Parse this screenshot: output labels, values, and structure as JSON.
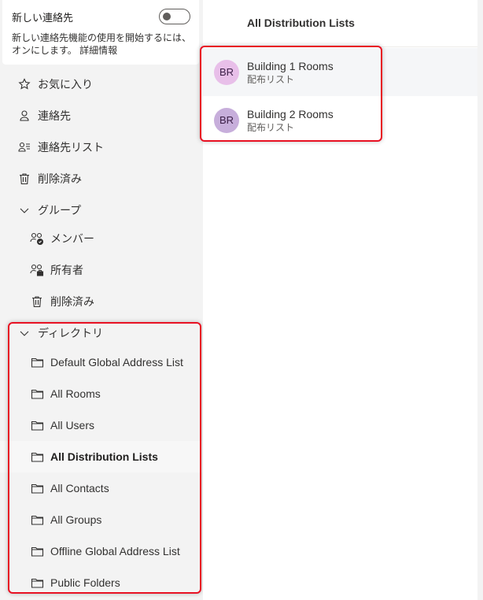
{
  "new_contacts": {
    "title": "新しい連絡先",
    "description": "新しい連絡先機能の使用を開始するには、オンにします。",
    "more_link": "詳細情報",
    "toggle_on": false
  },
  "nav": {
    "favorites": "お気に入り",
    "contacts": "連絡先",
    "contact_lists": "連絡先リスト",
    "deleted": "削除済み",
    "groups": {
      "label": "グループ",
      "expanded": true,
      "items": [
        {
          "label": "メンバー",
          "icon": "people-check-icon"
        },
        {
          "label": "所有者",
          "icon": "people-owner-icon"
        },
        {
          "label": "削除済み",
          "icon": "trash-icon"
        }
      ]
    },
    "directory": {
      "label": "ディレクトリ",
      "expanded": true,
      "items": [
        {
          "label": "Default Global Address List"
        },
        {
          "label": "All Rooms"
        },
        {
          "label": "All Users"
        },
        {
          "label": "All Distribution Lists",
          "selected": true
        },
        {
          "label": "All Contacts"
        },
        {
          "label": "All Groups"
        },
        {
          "label": "Offline Global Address List"
        },
        {
          "label": "Public Folders"
        }
      ]
    }
  },
  "main": {
    "header": "All Distribution Lists",
    "items": [
      {
        "initials": "BR",
        "name": "Building 1 Rooms",
        "type": "配布リスト",
        "avatar_color": "#e8bfe9",
        "selected": true
      },
      {
        "initials": "BR",
        "name": "Building 2 Rooms",
        "type": "配布リスト",
        "avatar_color": "#c7aedb",
        "selected": false
      }
    ]
  },
  "highlight_color": "#e81123"
}
